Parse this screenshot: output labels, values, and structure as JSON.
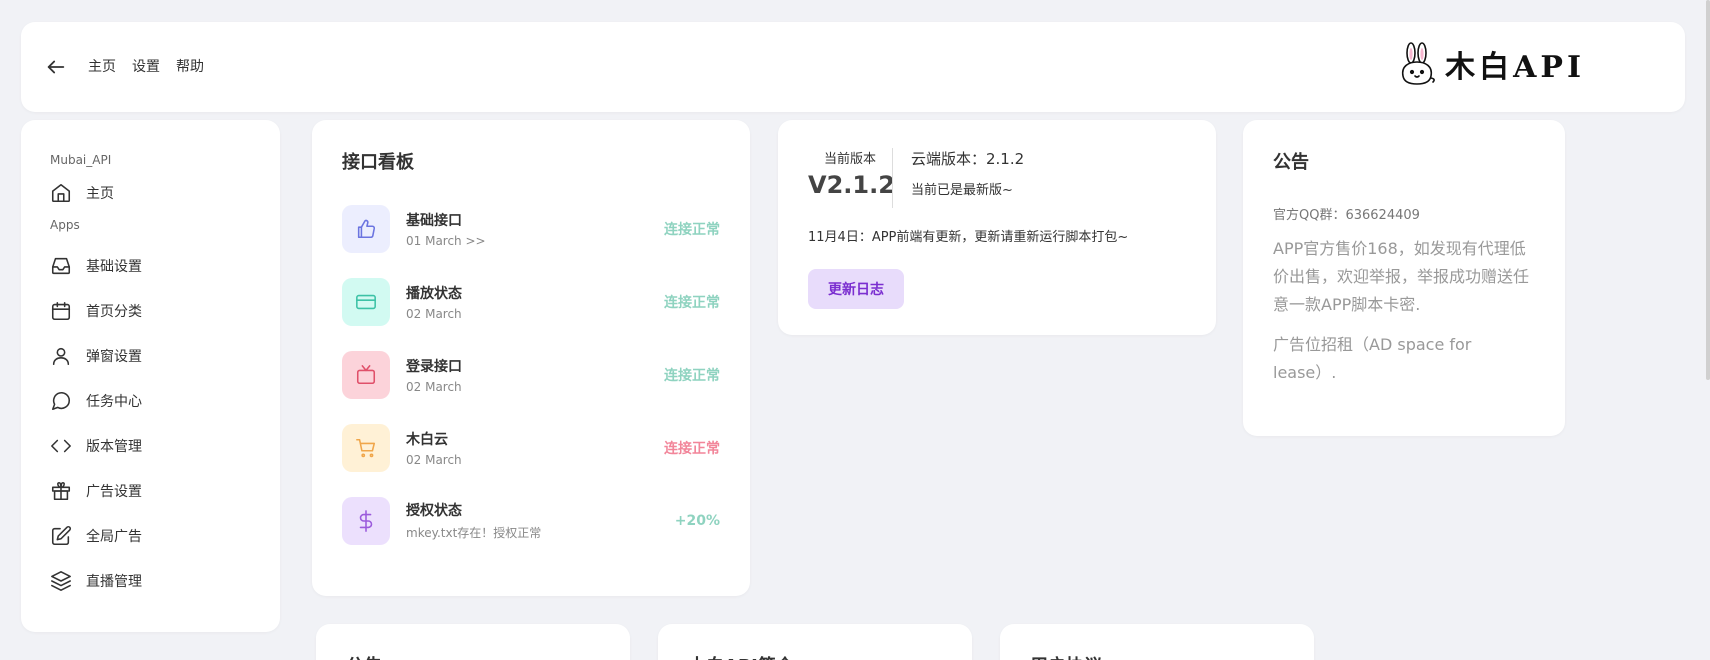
{
  "header": {
    "nav": [
      "主页",
      "设置",
      "帮助"
    ],
    "logo_text": "木白API"
  },
  "sidebar": {
    "section_top": "Mubai_API",
    "home_label": "主页",
    "section_apps": "Apps",
    "items": [
      {
        "label": "基础设置",
        "icon": "inbox-icon"
      },
      {
        "label": "首页分类",
        "icon": "calendar-icon"
      },
      {
        "label": "弹窗设置",
        "icon": "user-icon"
      },
      {
        "label": "任务中心",
        "icon": "message-icon"
      },
      {
        "label": "版本管理",
        "icon": "code-icon"
      },
      {
        "label": "广告设置",
        "icon": "gift-icon"
      },
      {
        "label": "全局广告",
        "icon": "edit-icon"
      },
      {
        "label": "直播管理",
        "icon": "layers-icon"
      }
    ]
  },
  "board": {
    "title": "接口看板",
    "rows": [
      {
        "title": "基础接口",
        "sub": "01 March >>",
        "status": "连接正常",
        "icon": "thumbs-up-icon",
        "bg": "#eceefe",
        "fg": "#6b74e0",
        "status_color": "#8fd3c0"
      },
      {
        "title": "播放状态",
        "sub": "02 March",
        "status": "连接正常",
        "icon": "credit-card-icon",
        "bg": "#d2faf2",
        "fg": "#3cc2a6",
        "status_color": "#8fd3c0"
      },
      {
        "title": "登录接口",
        "sub": "02 March",
        "status": "连接正常",
        "icon": "tv-icon",
        "bg": "#fcd3da",
        "fg": "#e0506a",
        "status_color": "#8fd3c0"
      },
      {
        "title": "木白云",
        "sub": "02 March",
        "status": "连接正常",
        "icon": "cart-icon",
        "bg": "#fff1d6",
        "fg": "#f0a64a",
        "status_color": "#f2869a"
      },
      {
        "title": "授权状态",
        "sub": "mkey.txt存在！授权正常",
        "status": "+20%",
        "icon": "dollar-icon",
        "bg": "#ece0fd",
        "fg": "#9b5bdc",
        "status_color": "#8fd3c0"
      }
    ]
  },
  "version": {
    "current_label": "当前版本",
    "current_value": "V2.1.2",
    "cloud_version": "云端版本：2.1.2",
    "cloud_note": "当前已是最新版~",
    "news": "11月4日：APP前端有更新，更新请重新运行脚本打包~",
    "log_button": "更新日志"
  },
  "notice": {
    "title": "公告",
    "qq": "官方QQ群：636624409",
    "p1": "APP官方售价168，如发现有代理低价出售，欢迎举报，举报成功赠送任意一款APP脚本卡密.",
    "p2": "广告位招租（AD space for lease）."
  },
  "bottom_cards": [
    "公告",
    "木白API简介",
    "用户协议"
  ]
}
